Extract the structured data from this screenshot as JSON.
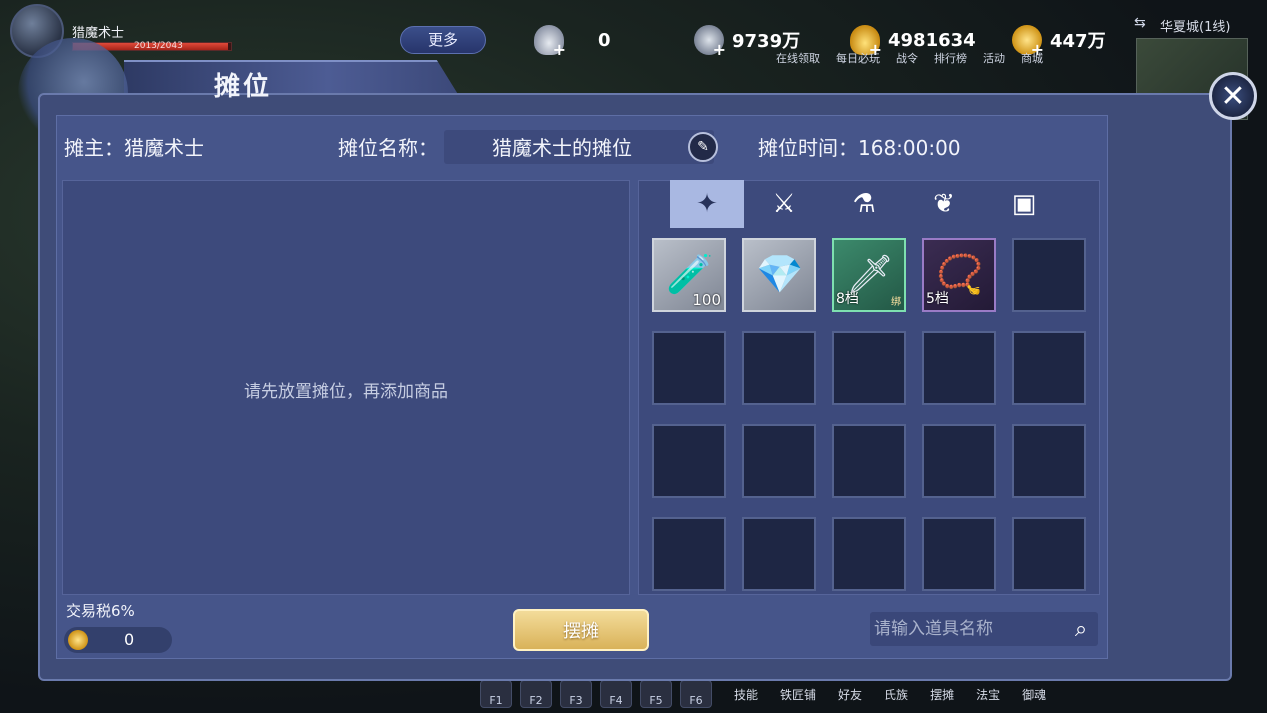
{
  "player": {
    "name": "猎魔术士",
    "hp": "2013/2043"
  },
  "top": {
    "more_label": "更多",
    "currencies": [
      {
        "icon": "silver-ingot-icon",
        "value": "0"
      },
      {
        "icon": "bound-silver-icon",
        "value": "9739万"
      },
      {
        "icon": "gold-ingot-icon",
        "value": "4981634"
      },
      {
        "icon": "coin-icon",
        "value": "447万"
      }
    ],
    "shortcut_labels": [
      "在线领取",
      "每日必玩",
      "战令",
      "排行榜",
      "活动",
      "商城"
    ],
    "city": "华夏城(1线)"
  },
  "panel": {
    "title": "摊位",
    "owner": "摊主：猎魔术士",
    "stall_name_label": "摊位名称：",
    "stall_name_value": "猎魔术士的摊位",
    "time": "摊位时间：168:00:00",
    "empty_hint": "请先放置摊位，再添加商品",
    "tabs": [
      {
        "name": "all",
        "icon": "diamond-icon",
        "glyph": "✦",
        "active": true
      },
      {
        "name": "weapon",
        "icon": "blade-icon",
        "glyph": "⚔"
      },
      {
        "name": "potion",
        "icon": "potion-icon",
        "glyph": "⚗"
      },
      {
        "name": "material",
        "icon": "leaf-icon",
        "glyph": "❦"
      },
      {
        "name": "chest",
        "icon": "chest-icon",
        "glyph": "▣"
      }
    ],
    "items": [
      {
        "icon": "potion-bottle-icon",
        "glyph": "🧪",
        "qty": "100",
        "style": "filled"
      },
      {
        "icon": "crystal-icon",
        "glyph": "💎",
        "qty": "",
        "style": "filled"
      },
      {
        "icon": "bracer-icon",
        "glyph": "🗡",
        "tier": "8档",
        "bound": "绑",
        "style": "green"
      },
      {
        "icon": "necklace-icon",
        "glyph": "📿",
        "tier": "5档",
        "style": "purple"
      }
    ],
    "total_slots": 20,
    "tax_label": "交易税6%",
    "tax_value": "0",
    "stall_button": "摆摊",
    "search_placeholder": "请输入道具名称"
  },
  "bottom": {
    "hotkeys": [
      "F1",
      "F2",
      "F3",
      "F4",
      "F5",
      "F6"
    ],
    "labels": [
      "技能",
      "铁匠铺",
      "好友",
      "氏族",
      "摆摊",
      "法宝",
      "御魂"
    ]
  }
}
